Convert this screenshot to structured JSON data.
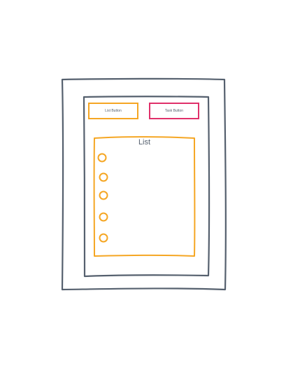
{
  "toolbar": {
    "list_button_label": "List Button",
    "task_button_label": "Task Button"
  },
  "list": {
    "title": "List",
    "item_count": 5
  },
  "colors": {
    "frame": "#55606e",
    "accent_orange": "#f5a623",
    "accent_pink": "#e0306a"
  }
}
